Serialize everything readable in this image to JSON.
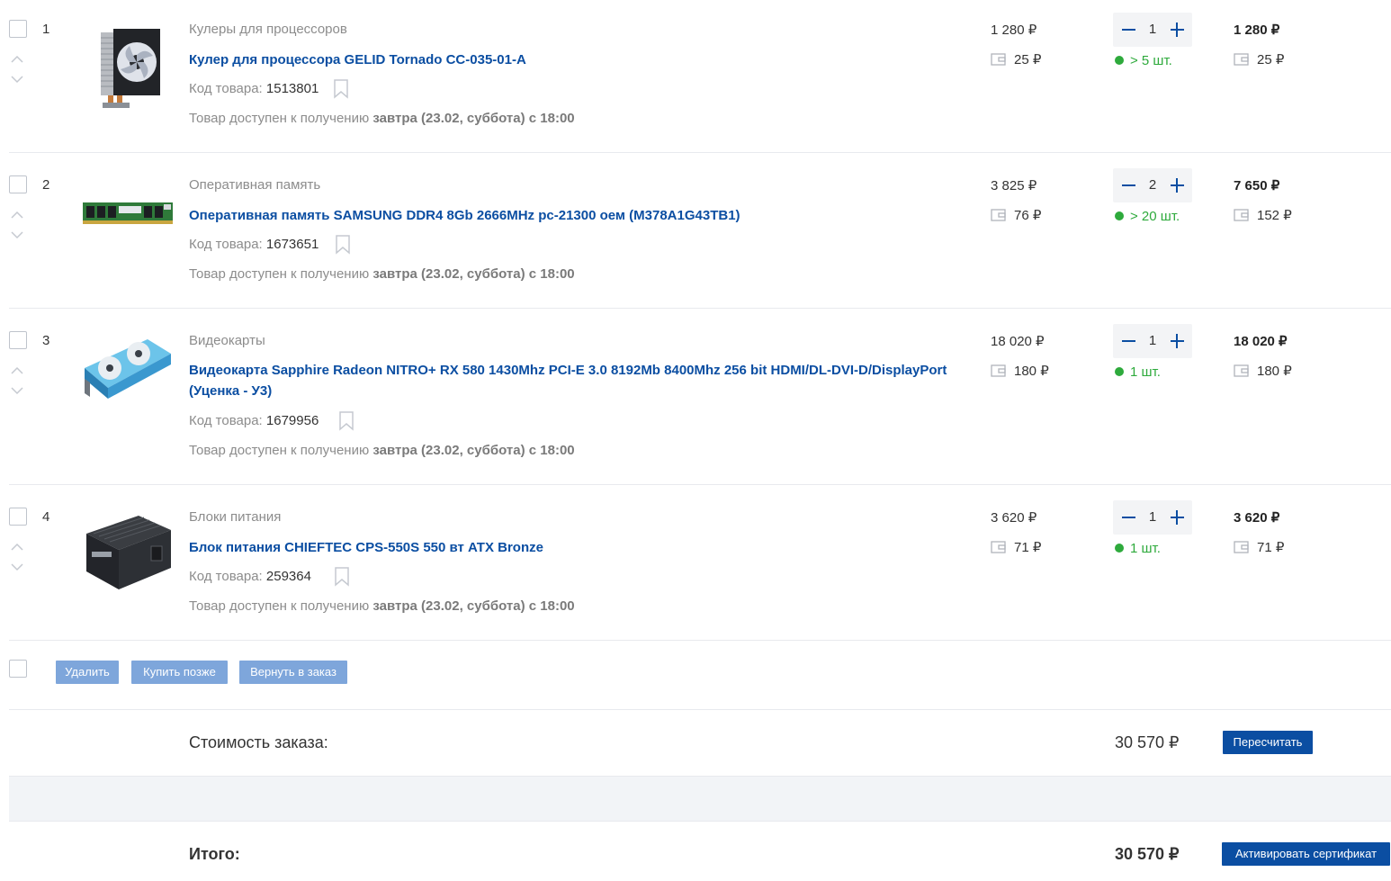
{
  "currency": "₽",
  "items": [
    {
      "index": "1",
      "category": "Кулеры для процессоров",
      "title": "Кулер для процессора GELID Tornado CC-035-01-A",
      "code_label": "Код товара:",
      "code": "1513801",
      "availability_prefix": "Товар доступен к получению",
      "availability_date": "завтра (23.02, суббота) с 18:00",
      "price": "1 280 ₽",
      "bonus": "25 ₽",
      "qty": "1",
      "stock": "> 5 шт.",
      "total": "1 280 ₽",
      "total_bonus": "25 ₽",
      "image": "cpu-cooler-image"
    },
    {
      "index": "2",
      "category": "Оперативная память",
      "title": "Оперативная память SAMSUNG DDR4 8Gb 2666MHz pc-21300 оем (M378A1G43TB1)",
      "code_label": "Код товара:",
      "code": "1673651",
      "availability_prefix": "Товар доступен к получению",
      "availability_date": "завтра (23.02, суббота) с 18:00",
      "price": "3 825 ₽",
      "bonus": "76 ₽",
      "qty": "2",
      "stock": "> 20 шт.",
      "total": "7 650 ₽",
      "total_bonus": "152 ₽",
      "image": "ram-module-image"
    },
    {
      "index": "3",
      "category": "Видеокарты",
      "title": "Видеокарта Sapphire Radeon NITRO+ RX 580 1430Mhz PCI-E 3.0 8192Mb 8400Mhz 256 bit HDMI/DL-DVI-D/DisplayPort (Уценка - У3)",
      "code_label": "Код товара:",
      "code": "1679956",
      "availability_prefix": "Товар доступен к получению",
      "availability_date": "завтра (23.02, суббота) с 18:00",
      "price": "18 020 ₽",
      "bonus": "180 ₽",
      "qty": "1",
      "stock": "1 шт.",
      "total": "18 020 ₽",
      "total_bonus": "180 ₽",
      "image": "graphics-card-image"
    },
    {
      "index": "4",
      "category": "Блоки питания",
      "title": "Блок питания CHIEFTEC CPS-550S 550 вт ATX Bronze",
      "code_label": "Код товара:",
      "code": "259364",
      "availability_prefix": "Товар доступен к получению",
      "availability_date": "завтра (23.02, суббота) с 18:00",
      "price": "3 620 ₽",
      "bonus": "71 ₽",
      "qty": "1",
      "stock": "1 шт.",
      "total": "3 620 ₽",
      "total_bonus": "71 ₽",
      "image": "power-supply-image"
    }
  ],
  "actions": {
    "delete": "Удалить",
    "buy_later": "Купить позже",
    "return_to_order": "Вернуть в заказ"
  },
  "summary": {
    "order_cost_label": "Стоимость заказа:",
    "order_cost": "30 570 ₽",
    "recalculate": "Пересчитать",
    "total_label": "Итого:",
    "total": "30 570 ₽",
    "activate_certificate": "Активировать сертификат"
  },
  "colors": {
    "link": "#0b4ea2",
    "stock_green": "#2eaa3c",
    "button_light": "#7ea6db",
    "button_dark": "#0b4ea2"
  }
}
